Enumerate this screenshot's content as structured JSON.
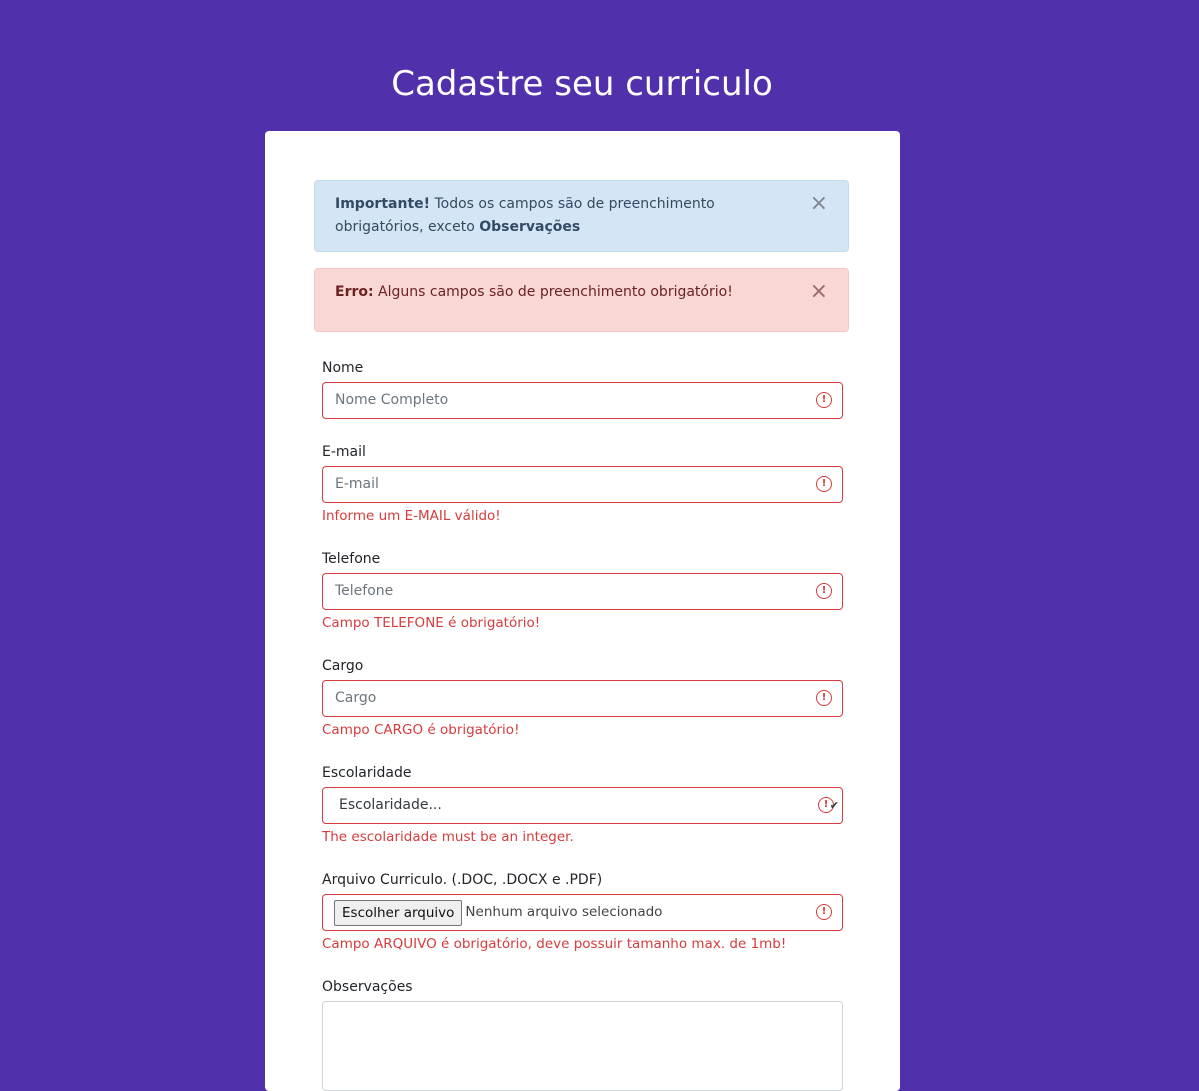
{
  "page": {
    "title": "Cadastre seu curriculo"
  },
  "alerts": {
    "info": {
      "strong": "Importante!",
      "text": " Todos os campos são de preenchimento obrigatórios, exceto ",
      "strong2": "Observações"
    },
    "error": {
      "strong": "Erro:",
      "text": " Alguns campos são de preenchimento obrigatório!"
    },
    "close_symbol": "×"
  },
  "form": {
    "nome": {
      "label": "Nome",
      "placeholder": "Nome Completo"
    },
    "email": {
      "label": "E-mail",
      "placeholder": "E-mail",
      "error": "Informe um E-MAIL válido!"
    },
    "telefone": {
      "label": "Telefone",
      "placeholder": "Telefone",
      "error": "Campo TELEFONE é obrigatório!"
    },
    "cargo": {
      "label": "Cargo",
      "placeholder": "Cargo",
      "error": "Campo CARGO é obrigatório!"
    },
    "escolaridade": {
      "label": "Escolaridade",
      "selected": "Escolaridade...",
      "error": "The escolaridade must be an integer."
    },
    "arquivo": {
      "label": "Arquivo Curriculo. (.DOC, .DOCX e .PDF)",
      "button": "Escolher arquivo",
      "status": "Nenhum arquivo selecionado",
      "error": "Campo ARQUIVO é obrigatório, deve possuir tamanho max. de 1mb!"
    },
    "observacoes": {
      "label": "Observações"
    }
  },
  "icons": {
    "error": "exclamation-circle-icon",
    "close": "close-icon",
    "chevron": "chevron-down-icon"
  },
  "colors": {
    "background": "#5131ab",
    "error": "#d63c3c",
    "info_bg": "#d4e6f6",
    "danger_bg": "#f8d7d5"
  }
}
